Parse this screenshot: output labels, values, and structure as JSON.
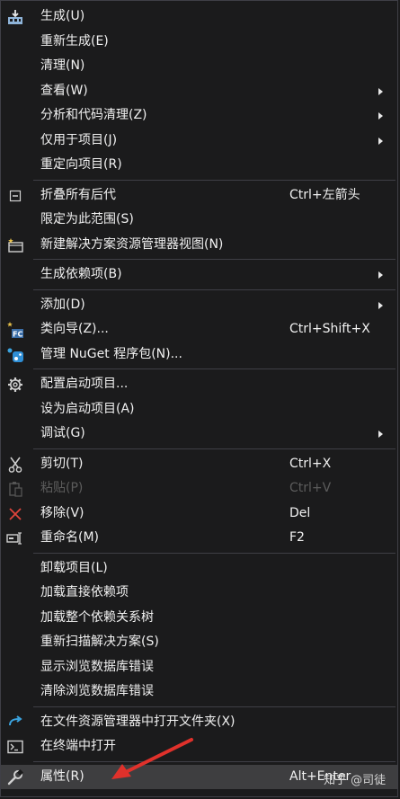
{
  "menu": {
    "items": [
      {
        "label": "生成(U)",
        "icon": "build-icon"
      },
      {
        "label": "重新生成(E)"
      },
      {
        "label": "清理(N)"
      },
      {
        "label": "查看(W)",
        "submenu": true
      },
      {
        "label": "分析和代码清理(Z)",
        "submenu": true
      },
      {
        "label": "仅用于项目(J)",
        "submenu": true
      },
      {
        "label": "重定向项目(R)"
      },
      {
        "separator": true
      },
      {
        "label": "折叠所有后代",
        "shortcut": "Ctrl+左箭头",
        "icon": "collapse-icon"
      },
      {
        "label": "限定为此范围(S)"
      },
      {
        "label": "新建解决方案资源管理器视图(N)",
        "icon": "new-view-icon"
      },
      {
        "separator": true
      },
      {
        "label": "生成依赖项(B)",
        "submenu": true
      },
      {
        "separator": true
      },
      {
        "label": "添加(D)",
        "submenu": true
      },
      {
        "label": "类向导(Z)...",
        "shortcut": "Ctrl+Shift+X",
        "icon": "class-wizard-icon"
      },
      {
        "label": "管理 NuGet 程序包(N)...",
        "icon": "nuget-icon"
      },
      {
        "separator": true
      },
      {
        "label": "配置启动项目...",
        "icon": "gear-icon"
      },
      {
        "label": "设为启动项目(A)"
      },
      {
        "label": "调试(G)",
        "submenu": true
      },
      {
        "separator": true
      },
      {
        "label": "剪切(T)",
        "shortcut": "Ctrl+X",
        "icon": "cut-icon"
      },
      {
        "label": "粘贴(P)",
        "shortcut": "Ctrl+V",
        "icon": "paste-icon",
        "disabled": true
      },
      {
        "label": "移除(V)",
        "shortcut": "Del",
        "icon": "remove-icon"
      },
      {
        "label": "重命名(M)",
        "shortcut": "F2",
        "icon": "rename-icon"
      },
      {
        "separator": true
      },
      {
        "label": "卸载项目(L)"
      },
      {
        "label": "加载直接依赖项"
      },
      {
        "label": "加载整个依赖关系树"
      },
      {
        "label": "重新扫描解决方案(S)"
      },
      {
        "label": "显示浏览数据库错误"
      },
      {
        "label": "清除浏览数据库错误"
      },
      {
        "separator": true
      },
      {
        "label": "在文件资源管理器中打开文件夹(X)",
        "icon": "open-folder-icon"
      },
      {
        "label": "在终端中打开",
        "icon": "terminal-icon"
      },
      {
        "separator": true
      },
      {
        "label": "属性(R)",
        "shortcut": "Alt+Enter",
        "icon": "wrench-icon",
        "highlighted": true
      }
    ]
  },
  "watermark": "知乎 @司徒",
  "colors": {
    "background": "#1b1b1c",
    "border": "#3f3f46",
    "hover": "#3e3e40",
    "text": "#f1f1f1",
    "disabled_text": "#5c5c5c",
    "annotation": "#e0312b"
  }
}
